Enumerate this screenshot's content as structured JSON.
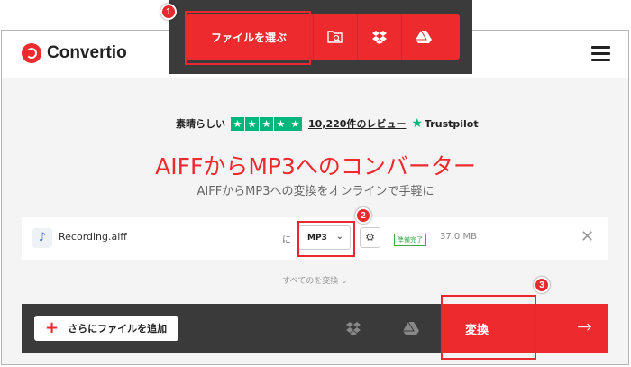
{
  "header": {
    "logo_text": "Convertio",
    "choose_files": "ファイルを選ぶ",
    "source_icons": [
      "folder-search-icon",
      "dropbox-icon",
      "google-drive-icon"
    ]
  },
  "rating": {
    "label": "素晴らしい",
    "stars": 5,
    "reviews": "10,220件のレビュー",
    "brand": "Trustpilot"
  },
  "hero": {
    "title": "AIFFからMP3へのコンバーター",
    "subtitle": "AIFFからMP3への変換をオンラインで手軽に"
  },
  "file": {
    "name": "Recording.aiff",
    "to": "に",
    "format": "MP3",
    "status": "準備完了",
    "size": "37.0 MB"
  },
  "convert_all": "すべてのを変換",
  "bottom": {
    "add_more": "さらにファイルを追加",
    "convert": "変換"
  },
  "annotations": [
    "1",
    "2",
    "3"
  ],
  "colors": {
    "brand_red": "#ed2b2f",
    "trustpilot_green": "#00b67a",
    "status_green": "#3bab46"
  }
}
